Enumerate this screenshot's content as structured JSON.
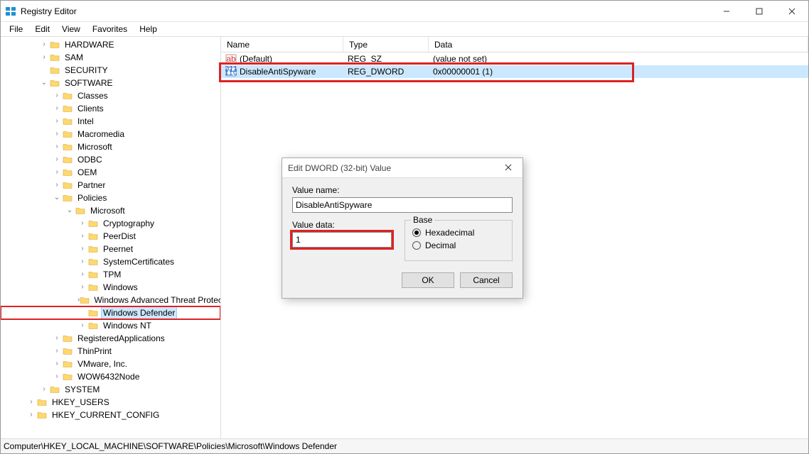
{
  "window": {
    "title": "Registry Editor"
  },
  "menu": [
    "File",
    "Edit",
    "View",
    "Favorites",
    "Help"
  ],
  "tree": [
    {
      "depth": 3,
      "tw": ">",
      "label": "HARDWARE"
    },
    {
      "depth": 3,
      "tw": ">",
      "label": "SAM"
    },
    {
      "depth": 3,
      "tw": "",
      "label": "SECURITY"
    },
    {
      "depth": 3,
      "tw": "v",
      "label": "SOFTWARE"
    },
    {
      "depth": 4,
      "tw": ">",
      "label": "Classes"
    },
    {
      "depth": 4,
      "tw": ">",
      "label": "Clients"
    },
    {
      "depth": 4,
      "tw": ">",
      "label": "Intel"
    },
    {
      "depth": 4,
      "tw": ">",
      "label": "Macromedia"
    },
    {
      "depth": 4,
      "tw": ">",
      "label": "Microsoft"
    },
    {
      "depth": 4,
      "tw": ">",
      "label": "ODBC"
    },
    {
      "depth": 4,
      "tw": ">",
      "label": "OEM"
    },
    {
      "depth": 4,
      "tw": ">",
      "label": "Partner"
    },
    {
      "depth": 4,
      "tw": "v",
      "label": "Policies"
    },
    {
      "depth": 5,
      "tw": "v",
      "label": "Microsoft"
    },
    {
      "depth": 6,
      "tw": ">",
      "label": "Cryptography"
    },
    {
      "depth": 6,
      "tw": ">",
      "label": "PeerDist"
    },
    {
      "depth": 6,
      "tw": ">",
      "label": "Peernet"
    },
    {
      "depth": 6,
      "tw": ">",
      "label": "SystemCertificates"
    },
    {
      "depth": 6,
      "tw": ">",
      "label": "TPM"
    },
    {
      "depth": 6,
      "tw": ">",
      "label": "Windows"
    },
    {
      "depth": 6,
      "tw": ">",
      "label": "Windows Advanced Threat Protection"
    },
    {
      "depth": 6,
      "tw": "",
      "label": "Windows Defender",
      "sel": true,
      "hl": true
    },
    {
      "depth": 6,
      "tw": ">",
      "label": "Windows NT"
    },
    {
      "depth": 4,
      "tw": ">",
      "label": "RegisteredApplications"
    },
    {
      "depth": 4,
      "tw": ">",
      "label": "ThinPrint"
    },
    {
      "depth": 4,
      "tw": ">",
      "label": "VMware, Inc."
    },
    {
      "depth": 4,
      "tw": ">",
      "label": "WOW6432Node"
    },
    {
      "depth": 3,
      "tw": ">",
      "label": "SYSTEM"
    },
    {
      "depth": 2,
      "tw": ">",
      "label": "HKEY_USERS"
    },
    {
      "depth": 2,
      "tw": ">",
      "label": "HKEY_CURRENT_CONFIG"
    }
  ],
  "list": {
    "headers": {
      "name": "Name",
      "type": "Type",
      "data": "Data"
    },
    "rows": [
      {
        "icon": "sz",
        "name": "(Default)",
        "type": "REG_SZ",
        "data": "(value not set)",
        "sel": false
      },
      {
        "icon": "bin",
        "name": "DisableAntiSpyware",
        "type": "REG_DWORD",
        "data": "0x00000001 (1)",
        "sel": true,
        "hl": true
      }
    ]
  },
  "statusbar": "Computer\\HKEY_LOCAL_MACHINE\\SOFTWARE\\Policies\\Microsoft\\Windows Defender",
  "dialog": {
    "title": "Edit DWORD (32-bit) Value",
    "valueNameLabel": "Value name:",
    "valueName": "DisableAntiSpyware",
    "valueDataLabel": "Value data:",
    "valueData": "1",
    "baseLabel": "Base",
    "hex": "Hexadecimal",
    "dec": "Decimal",
    "ok": "OK",
    "cancel": "Cancel"
  }
}
